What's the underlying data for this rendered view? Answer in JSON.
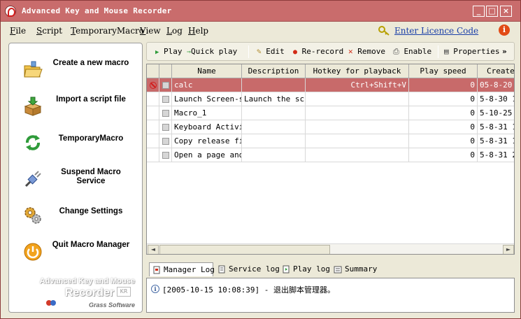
{
  "window": {
    "title": "Advanced Key and Mouse Recorder",
    "minimize_glyph": "_",
    "maximize_glyph": "□",
    "close_glyph": "×"
  },
  "menu": {
    "items": [
      "File",
      "Script",
      "TemporaryMacro",
      "View",
      "Log",
      "Help"
    ],
    "licence_link": "Enter Licence Code",
    "info_glyph": "i"
  },
  "tasks": [
    {
      "label": "Create a new macro",
      "icon": "folder-open-icon"
    },
    {
      "label": "Import a script file",
      "icon": "import-box-icon"
    },
    {
      "label": "TemporaryMacro",
      "icon": "recycle-arrows-icon"
    },
    {
      "label": "Suspend Macro Service",
      "icon": "plug-icon"
    },
    {
      "label": "Change Settings",
      "icon": "gears-icon"
    },
    {
      "label": "Quit Macro Manager",
      "icon": "power-icon"
    }
  ],
  "brand": {
    "line1": "Advanced Key and Mouse",
    "line2": "Recorder",
    "line3": "Grass Software",
    "kr": "KR"
  },
  "toolbar": {
    "play": "Play",
    "quick_play": "Quick play",
    "edit": "Edit",
    "rerecord": "Re-record",
    "remove": "Remove",
    "enable": "Enable",
    "properties": "Properties",
    "more": "»"
  },
  "grid": {
    "columns": [
      "Name",
      "Description",
      "Hotkey for playback",
      "Play speed",
      "Create"
    ],
    "rows": [
      {
        "name": "calc",
        "description": "",
        "hotkey": "Ctrl+Shift+V",
        "speed": "0",
        "created": "05-8-20 2",
        "disabled": true,
        "selected": true
      },
      {
        "name": "Launch Screen-sa",
        "description": "Launch the scr",
        "hotkey": "",
        "speed": "0",
        "created": "5-8-30 1",
        "disabled": false,
        "selected": false
      },
      {
        "name": "Macro_1",
        "description": "",
        "hotkey": "",
        "speed": "0",
        "created": "5-10-25 ",
        "disabled": false,
        "selected": false
      },
      {
        "name": "Keyboard Activit",
        "description": "",
        "hotkey": "",
        "speed": "0",
        "created": "5-8-31 1",
        "disabled": false,
        "selected": false
      },
      {
        "name": "Copy release fil",
        "description": "",
        "hotkey": "",
        "speed": "0",
        "created": "5-8-31 1",
        "disabled": false,
        "selected": false
      },
      {
        "name": "Open a page and",
        "description": "",
        "hotkey": "",
        "speed": "0",
        "created": "5-8-31 2",
        "disabled": false,
        "selected": false
      }
    ]
  },
  "scroll": {
    "left_glyph": "◄",
    "right_glyph": "►"
  },
  "logtabs": [
    "Manager Log",
    "Service log",
    "Play log",
    "Summary"
  ],
  "log": {
    "info_glyph": "i",
    "lines": [
      "[2005-10-15 10:08:39] - 退出脚本管理器。"
    ]
  },
  "colors": {
    "title_bar": "#c96c6c",
    "selection": "#c86a6a",
    "link": "#1a3fa8"
  }
}
